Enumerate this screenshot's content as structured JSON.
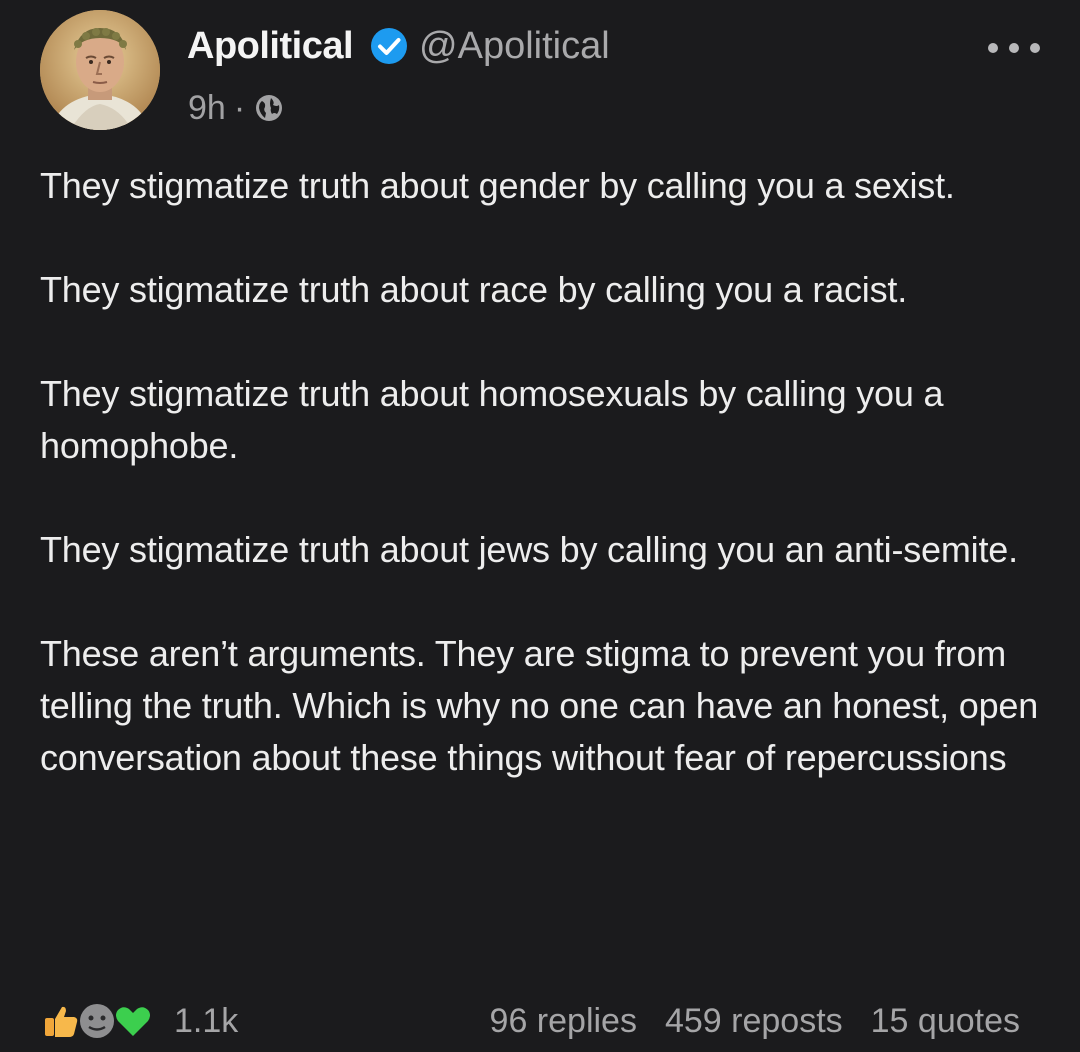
{
  "author": {
    "display_name": "Apolitical",
    "handle": "@Apolitical",
    "verified": true,
    "avatar_icon": "classical-bust-portrait",
    "verified_icon": "verified-badge-icon"
  },
  "meta": {
    "time_ago": "9h",
    "separator": "·",
    "visibility_icon": "globe-icon"
  },
  "menu_icon": "more-options-icon",
  "body": {
    "paragraphs": [
      "They stigmatize truth about gender by calling you a sexist.",
      "They stigmatize truth about race by calling you a racist.",
      "They stigmatize truth about homosexuals by calling you a homophobe.",
      "They stigmatize truth about jews by calling you an anti-semite.",
      "These aren’t arguments. They are stigma to prevent you from telling the truth. Which is why no one can have an honest, open conversation about these things without fear of repercussions"
    ]
  },
  "footer": {
    "reaction_icons": [
      "thumbs-up-icon",
      "face-reaction-icon",
      "green-heart-icon"
    ],
    "reaction_count": "1.1k",
    "replies": "96 replies",
    "reposts": "459 reposts",
    "quotes": "15 quotes"
  },
  "colors": {
    "background": "#1b1b1d",
    "text": "#ededed",
    "muted": "#a5a5a7",
    "verified_blue": "#1d9bf0",
    "heart_green": "#3ccf4e"
  }
}
